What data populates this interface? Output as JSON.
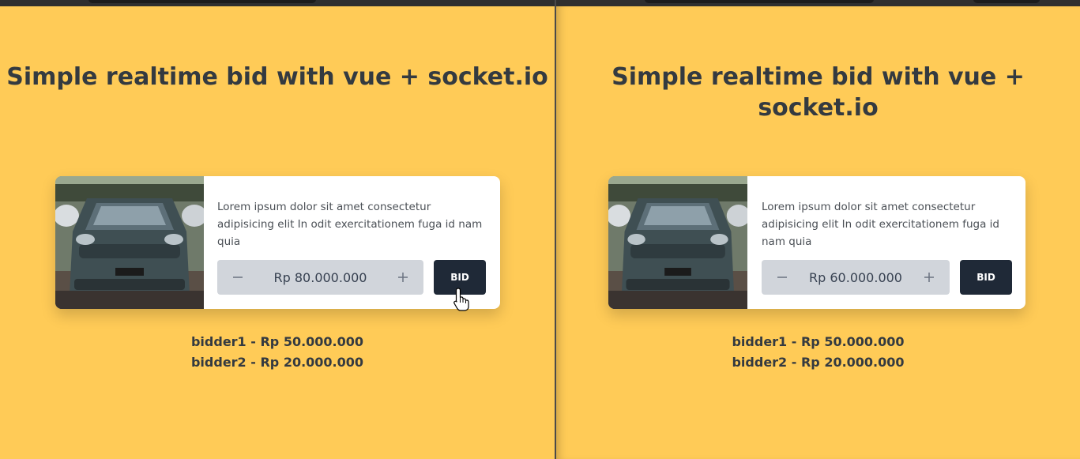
{
  "panes": [
    {
      "title": "Simple realtime bid with vue + socket.io",
      "card": {
        "image_icon": "car-photo",
        "description": "Lorem ipsum dolor sit amet consectetur adipisicing elit In odit exercitationem fuga id nam quia",
        "decrement_symbol": "−",
        "amount": "Rp 80.000.000",
        "increment_symbol": "+",
        "bid_label": "BID"
      },
      "bidders": [
        "bidder1 - Rp 50.000.000",
        "bidder2 - Rp 20.000.000"
      ]
    },
    {
      "title": "Simple realtime bid with vue + socket.io",
      "card": {
        "image_icon": "car-photo",
        "description": "Lorem ipsum dolor sit amet consectetur adipisicing elit In odit exercitationem fuga id nam quia",
        "decrement_symbol": "−",
        "amount": "Rp 60.000.000",
        "increment_symbol": "+",
        "bid_label": "BID"
      },
      "bidders": [
        "bidder1 - Rp 50.000.000",
        "bidder2 - Rp 20.000.000"
      ]
    }
  ],
  "colors": {
    "background": "#ffcb57",
    "card": "#ffffff",
    "stepper": "#d1d5db",
    "bid_button": "#1f2937",
    "text_dark": "#343a40"
  },
  "cursor_icon": "hand-pointer-icon"
}
